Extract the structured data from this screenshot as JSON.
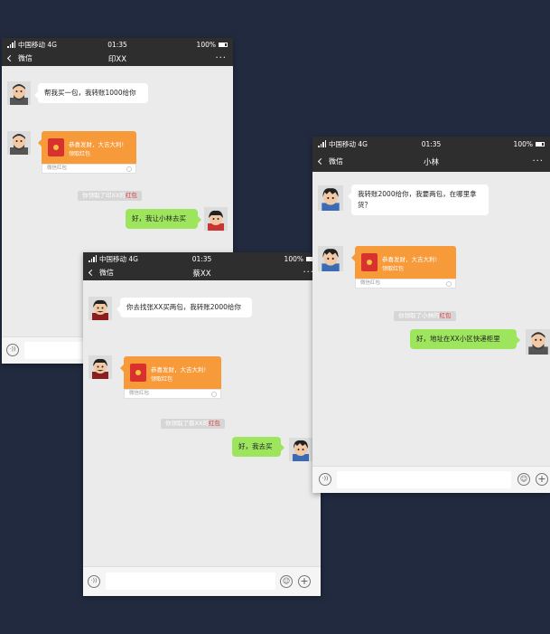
{
  "status": {
    "carrier": "中国移动 4G",
    "time": "01:35",
    "battery": "100%"
  },
  "phones": {
    "yin": {
      "back_label": "微信",
      "title": "印XX",
      "more": "···",
      "msg1": "帮我买一包，我转账1000给你",
      "rp_title": "恭喜发财，大吉大利!",
      "rp_sub": "领取红包",
      "rp_footer": "微信红包",
      "sys_text": "你领取了印XX的",
      "sys_red": "红包",
      "reply": "好，我让小林去买",
      "voice": "·))"
    },
    "cai": {
      "back_label": "微信",
      "title": "蔡XX",
      "more": "···",
      "msg1": "你去找张XX买两包，我转账2000给你",
      "rp_title": "恭喜发财，大吉大利!",
      "rp_sub": "领取红包",
      "rp_footer": "微信红包",
      "sys_text": "你领取了蔡XX的",
      "sys_red": "红包",
      "reply": "好，我去买",
      "voice": "·))",
      "emoji": "☺",
      "plus": "+"
    },
    "lin": {
      "back_label": "微信",
      "title": "小林",
      "more": "···",
      "msg1": "我转账2000给你，我要两包，在哪里拿货？",
      "rp_title": "恭喜发财，大吉大利!",
      "rp_sub": "领取红包",
      "rp_footer": "微信红包",
      "sys_text": "你领取了小林的",
      "sys_red": "红包",
      "reply": "好，地址在XX小区快递柜里",
      "voice": "·))",
      "emoji": "☺",
      "plus": "+"
    }
  },
  "colors": {
    "bg": "#222a40",
    "header": "#2e2e2e",
    "bubble_green": "#9ee55e",
    "redpacket": "#f79a3a"
  }
}
